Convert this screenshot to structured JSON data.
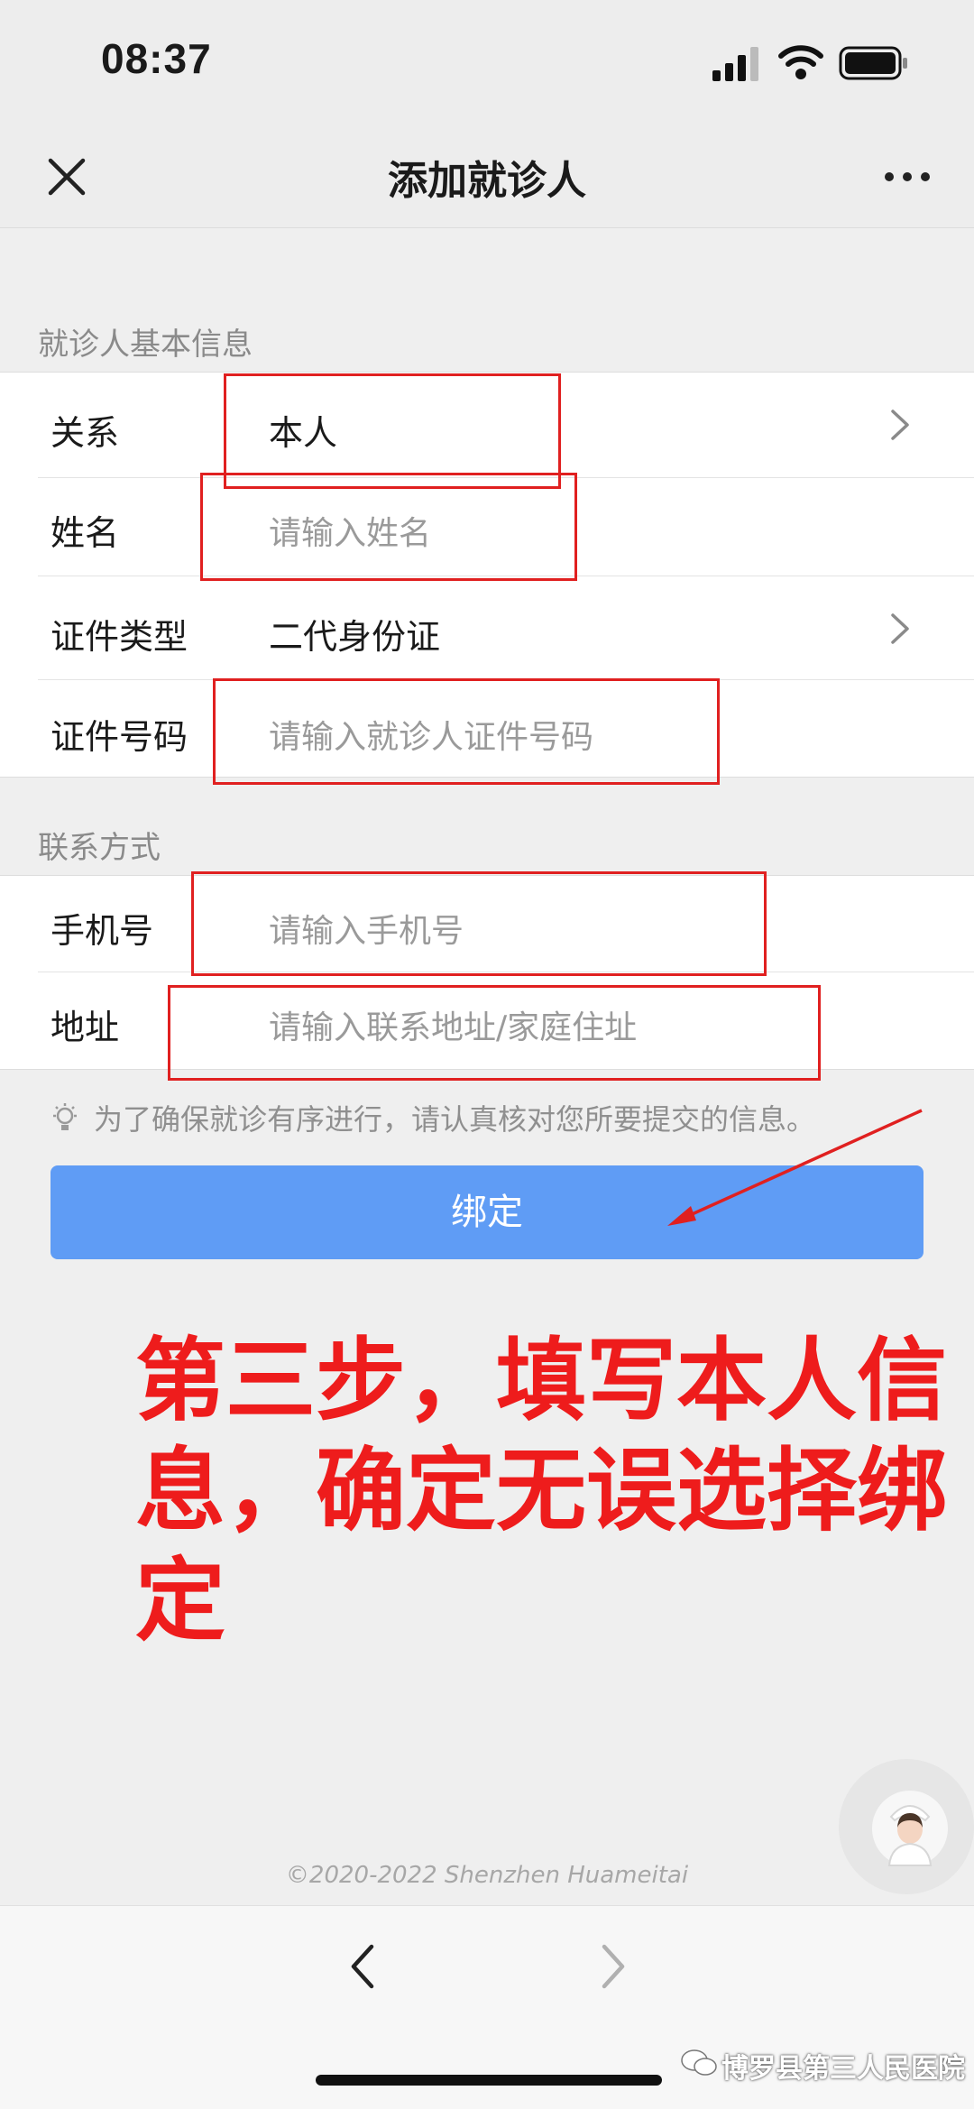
{
  "status_bar": {
    "time": "08:37"
  },
  "nav": {
    "title": "添加就诊人"
  },
  "basic_info": {
    "section_title": "就诊人基本信息",
    "rows": [
      {
        "label": "关系",
        "value": "本人",
        "has_arrow": true
      },
      {
        "label": "姓名",
        "placeholder": "请输入姓名"
      },
      {
        "label": "证件类型",
        "value": "二代身份证",
        "has_arrow": true
      },
      {
        "label": "证件号码",
        "placeholder": "请输入就诊人证件号码"
      }
    ]
  },
  "contact": {
    "section_title": "联系方式",
    "rows": [
      {
        "label": "手机号",
        "placeholder": "请输入手机号"
      },
      {
        "label": "地址",
        "placeholder": "请输入联系地址/家庭住址"
      }
    ]
  },
  "tip": "为了确保就诊有序进行，请认真核对您所要提交的信息。",
  "bind_button": "绑定",
  "annotation": {
    "line1": "第三步，填写本人信",
    "line2": "息，确定无误选择绑定",
    "color": "#ee1c1c"
  },
  "copyright": "©2020-2022 Shenzhen Huameitai",
  "watermark": "博罗县第三人民医院",
  "colors": {
    "accent": "#5f9cf5",
    "annotation_box": "#e02020"
  }
}
